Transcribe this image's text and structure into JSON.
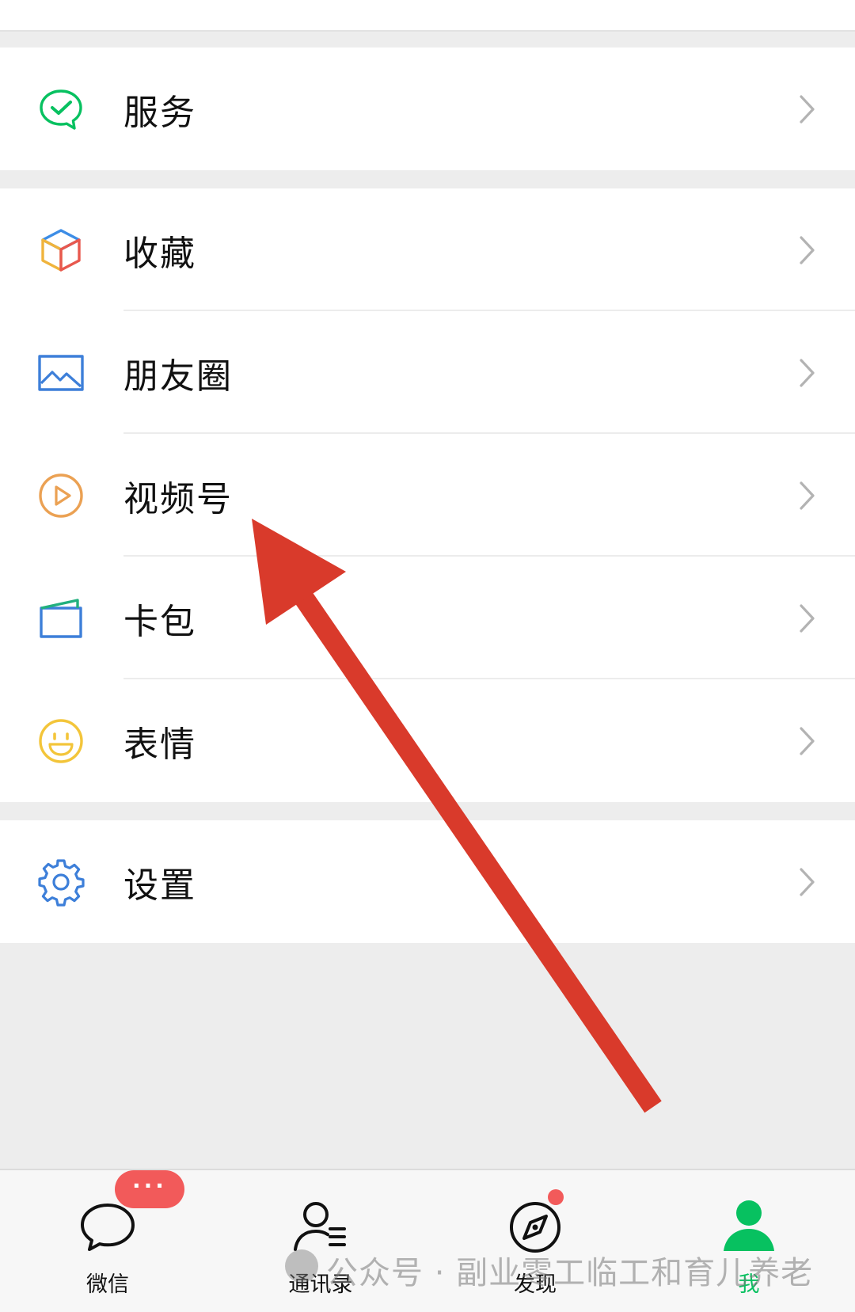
{
  "groups": {
    "service": [
      {
        "label": "服务",
        "icon": "wechat-pay-icon"
      }
    ],
    "main": [
      {
        "label": "收藏",
        "icon": "favorites-cube-icon"
      },
      {
        "label": "朋友圈",
        "icon": "moments-picture-icon"
      },
      {
        "label": "视频号",
        "icon": "channels-play-icon"
      },
      {
        "label": "卡包",
        "icon": "card-wallet-icon"
      },
      {
        "label": "表情",
        "icon": "sticker-smile-icon"
      }
    ],
    "settings": [
      {
        "label": "设置",
        "icon": "settings-gear-icon"
      }
    ]
  },
  "tabbar": {
    "tabs": [
      {
        "label": "微信",
        "icon": "chat-bubble-icon",
        "active": false
      },
      {
        "label": "通讯录",
        "icon": "contacts-icon",
        "active": false
      },
      {
        "label": "发现",
        "icon": "compass-icon",
        "active": false
      },
      {
        "label": "我",
        "icon": "person-icon",
        "active": true
      }
    ],
    "chat_badge": "···"
  },
  "watermark": "公众号 · 副业零工临工和育儿养老",
  "colors": {
    "accent_green": "#07c160",
    "badge_red": "#f25a5a",
    "arrow_red": "#d93a2b",
    "background": "#ededed"
  }
}
